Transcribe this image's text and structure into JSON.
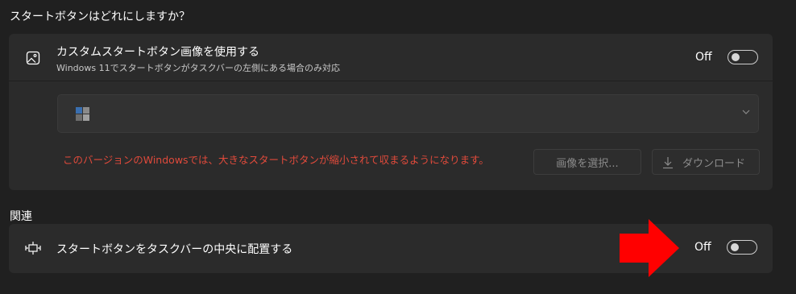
{
  "section_start": {
    "heading": "スタートボタンはどれにしますか？"
  },
  "custom_image": {
    "title": "カスタムスタートボタン画像を使用する",
    "subtitle": "Windows 11でスタートボタンがタスクバーの左側にある場合のみ対応",
    "toggle_state": "Off",
    "toggle_on": false,
    "icon": "image-icon",
    "dropdown_icon": "chevron-down-icon",
    "warning": "このバージョンのWindowsでは、大きなスタートボタンが縮小されて収まるようになります。",
    "select_image_label": "画像を選択...",
    "download_label": "ダウンロード",
    "download_icon": "download-icon"
  },
  "section_related": {
    "heading": "関連"
  },
  "center_taskbar": {
    "title": "スタートボタンをタスクバーの中央に配置する",
    "toggle_state": "Off",
    "toggle_on": false,
    "icon": "taskbar-center-icon"
  },
  "annotation": {
    "icon": "red-arrow-icon",
    "color": "#ff0000"
  },
  "colors": {
    "background": "#202020",
    "card": "#2b2b2b",
    "warning": "#e04a3b"
  }
}
